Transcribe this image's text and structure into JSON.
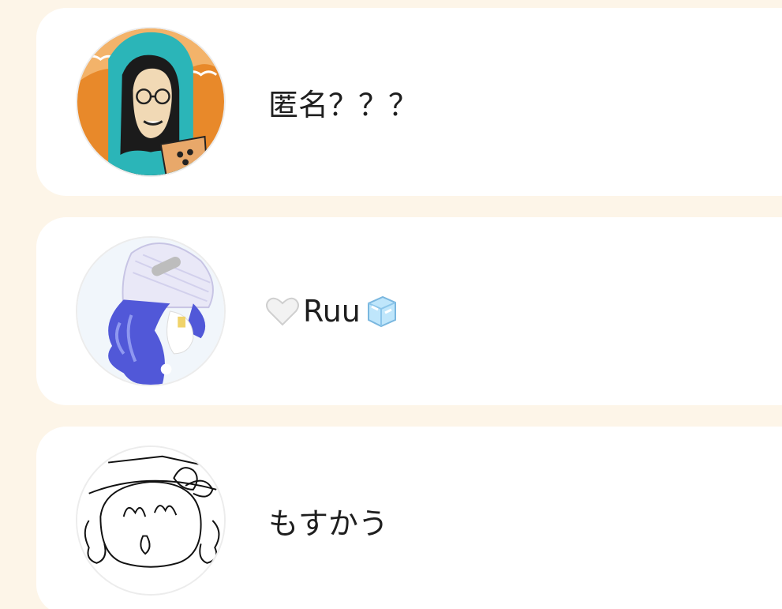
{
  "users": [
    {
      "name": "匿名？？？",
      "avatar_icon": "person-with-coffee-avatar",
      "avatar_accent": "#e8892a"
    },
    {
      "name": "Ruu",
      "prefix_icon": "white-heart-icon",
      "suffix_icon": "ice-cube-icon",
      "avatar_icon": "anime-character-avatar",
      "avatar_accent": "#5a5fd6"
    },
    {
      "name": "もすかう",
      "avatar_icon": "line-sketch-avatar",
      "avatar_accent": "#111111"
    }
  ]
}
